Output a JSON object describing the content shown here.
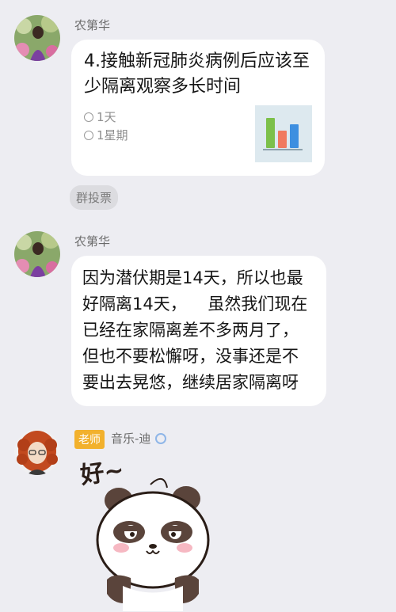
{
  "messages": [
    {
      "sender": "农第华",
      "type": "poll",
      "question": "4.接触新冠肺炎病例后应该至少隔离观察多长时间",
      "options": [
        "1天",
        "1星期"
      ],
      "chart_colors": [
        "#7cc04a",
        "#f07a5f",
        "#3d8fe0"
      ],
      "tag": "群投票"
    },
    {
      "sender": "农第华",
      "type": "text",
      "text": "因为潜伏期是14天，所以也最好隔离14天，    虽然我们现在已经在家隔离差不多两月了，但也不要松懈呀，没事还是不要出去晃悠，继续居家隔离呀"
    },
    {
      "sender": "音乐-迪",
      "role_badge": "老师",
      "type": "sticker",
      "sticker_caption": "好~"
    }
  ],
  "colors": {
    "background": "#ededf2",
    "bubble": "#ffffff",
    "badge": "#f2b12d"
  }
}
